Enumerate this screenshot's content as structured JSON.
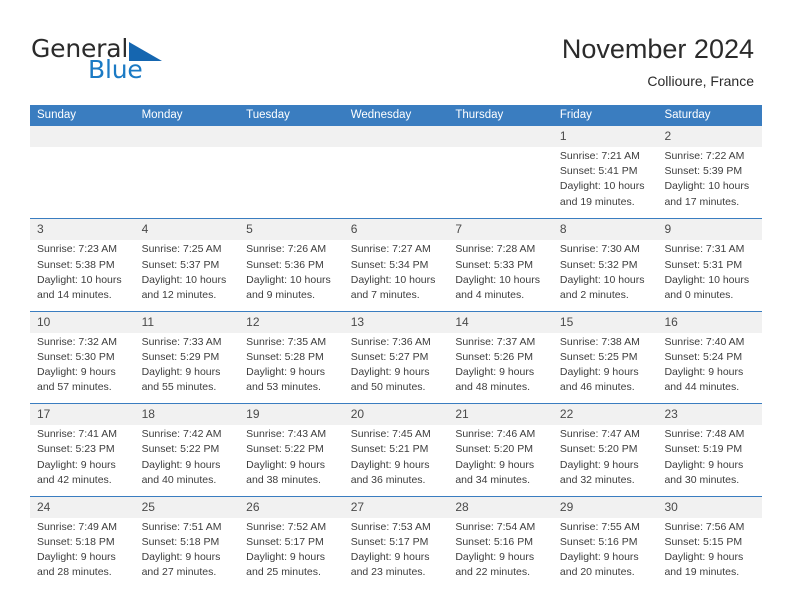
{
  "brand": {
    "name_part1": "General",
    "name_part2": "Blue",
    "logo_icon": "triangle-flag-icon"
  },
  "header": {
    "title": "November 2024",
    "subtitle": "Collioure, France"
  },
  "colors": {
    "header_blue": "#3a7dc0",
    "brand_blue": "#1b7ac4",
    "date_band": "#f1f1f1",
    "text": "#3d3d3d"
  },
  "weekdays": [
    "Sunday",
    "Monday",
    "Tuesday",
    "Wednesday",
    "Thursday",
    "Friday",
    "Saturday"
  ],
  "weeks": [
    [
      {
        "day": "",
        "sunrise": "",
        "sunset": "",
        "daylight_line1": "",
        "daylight_line2": "",
        "empty": true
      },
      {
        "day": "",
        "sunrise": "",
        "sunset": "",
        "daylight_line1": "",
        "daylight_line2": "",
        "empty": true
      },
      {
        "day": "",
        "sunrise": "",
        "sunset": "",
        "daylight_line1": "",
        "daylight_line2": "",
        "empty": true
      },
      {
        "day": "",
        "sunrise": "",
        "sunset": "",
        "daylight_line1": "",
        "daylight_line2": "",
        "empty": true
      },
      {
        "day": "",
        "sunrise": "",
        "sunset": "",
        "daylight_line1": "",
        "daylight_line2": "",
        "empty": true
      },
      {
        "day": "1",
        "sunrise": "Sunrise: 7:21 AM",
        "sunset": "Sunset: 5:41 PM",
        "daylight_line1": "Daylight: 10 hours",
        "daylight_line2": "and 19 minutes.",
        "empty": false
      },
      {
        "day": "2",
        "sunrise": "Sunrise: 7:22 AM",
        "sunset": "Sunset: 5:39 PM",
        "daylight_line1": "Daylight: 10 hours",
        "daylight_line2": "and 17 minutes.",
        "empty": false
      }
    ],
    [
      {
        "day": "3",
        "sunrise": "Sunrise: 7:23 AM",
        "sunset": "Sunset: 5:38 PM",
        "daylight_line1": "Daylight: 10 hours",
        "daylight_line2": "and 14 minutes.",
        "empty": false
      },
      {
        "day": "4",
        "sunrise": "Sunrise: 7:25 AM",
        "sunset": "Sunset: 5:37 PM",
        "daylight_line1": "Daylight: 10 hours",
        "daylight_line2": "and 12 minutes.",
        "empty": false
      },
      {
        "day": "5",
        "sunrise": "Sunrise: 7:26 AM",
        "sunset": "Sunset: 5:36 PM",
        "daylight_line1": "Daylight: 10 hours",
        "daylight_line2": "and 9 minutes.",
        "empty": false
      },
      {
        "day": "6",
        "sunrise": "Sunrise: 7:27 AM",
        "sunset": "Sunset: 5:34 PM",
        "daylight_line1": "Daylight: 10 hours",
        "daylight_line2": "and 7 minutes.",
        "empty": false
      },
      {
        "day": "7",
        "sunrise": "Sunrise: 7:28 AM",
        "sunset": "Sunset: 5:33 PM",
        "daylight_line1": "Daylight: 10 hours",
        "daylight_line2": "and 4 minutes.",
        "empty": false
      },
      {
        "day": "8",
        "sunrise": "Sunrise: 7:30 AM",
        "sunset": "Sunset: 5:32 PM",
        "daylight_line1": "Daylight: 10 hours",
        "daylight_line2": "and 2 minutes.",
        "empty": false
      },
      {
        "day": "9",
        "sunrise": "Sunrise: 7:31 AM",
        "sunset": "Sunset: 5:31 PM",
        "daylight_line1": "Daylight: 10 hours",
        "daylight_line2": "and 0 minutes.",
        "empty": false
      }
    ],
    [
      {
        "day": "10",
        "sunrise": "Sunrise: 7:32 AM",
        "sunset": "Sunset: 5:30 PM",
        "daylight_line1": "Daylight: 9 hours",
        "daylight_line2": "and 57 minutes.",
        "empty": false
      },
      {
        "day": "11",
        "sunrise": "Sunrise: 7:33 AM",
        "sunset": "Sunset: 5:29 PM",
        "daylight_line1": "Daylight: 9 hours",
        "daylight_line2": "and 55 minutes.",
        "empty": false
      },
      {
        "day": "12",
        "sunrise": "Sunrise: 7:35 AM",
        "sunset": "Sunset: 5:28 PM",
        "daylight_line1": "Daylight: 9 hours",
        "daylight_line2": "and 53 minutes.",
        "empty": false
      },
      {
        "day": "13",
        "sunrise": "Sunrise: 7:36 AM",
        "sunset": "Sunset: 5:27 PM",
        "daylight_line1": "Daylight: 9 hours",
        "daylight_line2": "and 50 minutes.",
        "empty": false
      },
      {
        "day": "14",
        "sunrise": "Sunrise: 7:37 AM",
        "sunset": "Sunset: 5:26 PM",
        "daylight_line1": "Daylight: 9 hours",
        "daylight_line2": "and 48 minutes.",
        "empty": false
      },
      {
        "day": "15",
        "sunrise": "Sunrise: 7:38 AM",
        "sunset": "Sunset: 5:25 PM",
        "daylight_line1": "Daylight: 9 hours",
        "daylight_line2": "and 46 minutes.",
        "empty": false
      },
      {
        "day": "16",
        "sunrise": "Sunrise: 7:40 AM",
        "sunset": "Sunset: 5:24 PM",
        "daylight_line1": "Daylight: 9 hours",
        "daylight_line2": "and 44 minutes.",
        "empty": false
      }
    ],
    [
      {
        "day": "17",
        "sunrise": "Sunrise: 7:41 AM",
        "sunset": "Sunset: 5:23 PM",
        "daylight_line1": "Daylight: 9 hours",
        "daylight_line2": "and 42 minutes.",
        "empty": false
      },
      {
        "day": "18",
        "sunrise": "Sunrise: 7:42 AM",
        "sunset": "Sunset: 5:22 PM",
        "daylight_line1": "Daylight: 9 hours",
        "daylight_line2": "and 40 minutes.",
        "empty": false
      },
      {
        "day": "19",
        "sunrise": "Sunrise: 7:43 AM",
        "sunset": "Sunset: 5:22 PM",
        "daylight_line1": "Daylight: 9 hours",
        "daylight_line2": "and 38 minutes.",
        "empty": false
      },
      {
        "day": "20",
        "sunrise": "Sunrise: 7:45 AM",
        "sunset": "Sunset: 5:21 PM",
        "daylight_line1": "Daylight: 9 hours",
        "daylight_line2": "and 36 minutes.",
        "empty": false
      },
      {
        "day": "21",
        "sunrise": "Sunrise: 7:46 AM",
        "sunset": "Sunset: 5:20 PM",
        "daylight_line1": "Daylight: 9 hours",
        "daylight_line2": "and 34 minutes.",
        "empty": false
      },
      {
        "day": "22",
        "sunrise": "Sunrise: 7:47 AM",
        "sunset": "Sunset: 5:20 PM",
        "daylight_line1": "Daylight: 9 hours",
        "daylight_line2": "and 32 minutes.",
        "empty": false
      },
      {
        "day": "23",
        "sunrise": "Sunrise: 7:48 AM",
        "sunset": "Sunset: 5:19 PM",
        "daylight_line1": "Daylight: 9 hours",
        "daylight_line2": "and 30 minutes.",
        "empty": false
      }
    ],
    [
      {
        "day": "24",
        "sunrise": "Sunrise: 7:49 AM",
        "sunset": "Sunset: 5:18 PM",
        "daylight_line1": "Daylight: 9 hours",
        "daylight_line2": "and 28 minutes.",
        "empty": false
      },
      {
        "day": "25",
        "sunrise": "Sunrise: 7:51 AM",
        "sunset": "Sunset: 5:18 PM",
        "daylight_line1": "Daylight: 9 hours",
        "daylight_line2": "and 27 minutes.",
        "empty": false
      },
      {
        "day": "26",
        "sunrise": "Sunrise: 7:52 AM",
        "sunset": "Sunset: 5:17 PM",
        "daylight_line1": "Daylight: 9 hours",
        "daylight_line2": "and 25 minutes.",
        "empty": false
      },
      {
        "day": "27",
        "sunrise": "Sunrise: 7:53 AM",
        "sunset": "Sunset: 5:17 PM",
        "daylight_line1": "Daylight: 9 hours",
        "daylight_line2": "and 23 minutes.",
        "empty": false
      },
      {
        "day": "28",
        "sunrise": "Sunrise: 7:54 AM",
        "sunset": "Sunset: 5:16 PM",
        "daylight_line1": "Daylight: 9 hours",
        "daylight_line2": "and 22 minutes.",
        "empty": false
      },
      {
        "day": "29",
        "sunrise": "Sunrise: 7:55 AM",
        "sunset": "Sunset: 5:16 PM",
        "daylight_line1": "Daylight: 9 hours",
        "daylight_line2": "and 20 minutes.",
        "empty": false
      },
      {
        "day": "30",
        "sunrise": "Sunrise: 7:56 AM",
        "sunset": "Sunset: 5:15 PM",
        "daylight_line1": "Daylight: 9 hours",
        "daylight_line2": "and 19 minutes.",
        "empty": false
      }
    ]
  ]
}
